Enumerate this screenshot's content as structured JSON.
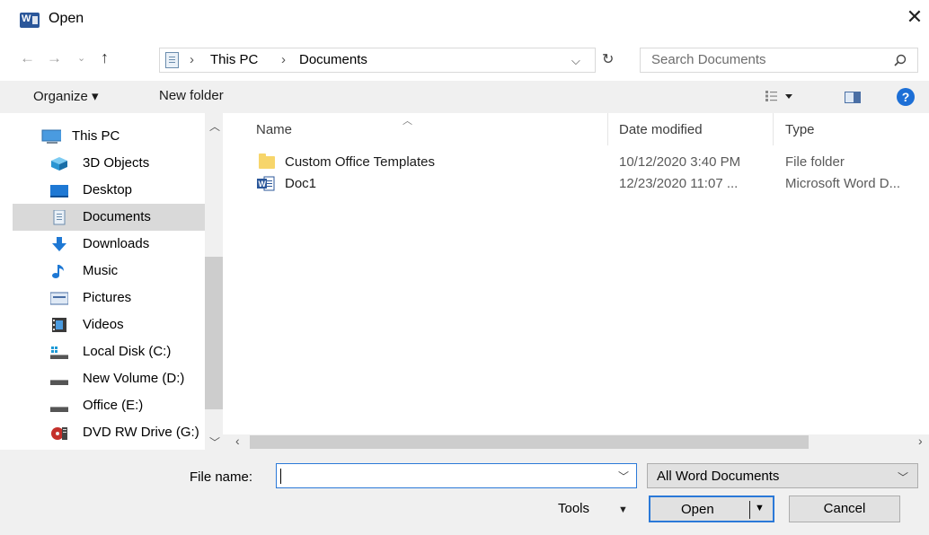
{
  "window": {
    "title": "Open",
    "icon": "word-app-icon",
    "close_icon": "close-icon"
  },
  "nav": {
    "back_icon": "arrow-left-icon",
    "forward_icon": "arrow-right-icon",
    "recent_icon": "chevron-down-icon",
    "up_icon": "arrow-up-icon",
    "breadcrumb": [
      "This PC",
      "Documents"
    ],
    "separator": "›",
    "refresh_icon": "refresh-icon",
    "search_placeholder": "Search Documents"
  },
  "toolbar": {
    "organize_label": "Organize ▾",
    "new_folder_label": "New folder",
    "view_icon": "view-options-icon",
    "preview_pane_icon": "preview-pane-icon",
    "help_label": "?"
  },
  "sidebar": {
    "items": [
      {
        "label": "This PC",
        "icon": "computer-icon",
        "selected": false
      },
      {
        "label": "3D Objects",
        "icon": "3d-objects-icon",
        "selected": false
      },
      {
        "label": "Desktop",
        "icon": "desktop-icon",
        "selected": false
      },
      {
        "label": "Documents",
        "icon": "documents-icon",
        "selected": true
      },
      {
        "label": "Downloads",
        "icon": "downloads-icon",
        "selected": false
      },
      {
        "label": "Music",
        "icon": "music-icon",
        "selected": false
      },
      {
        "label": "Pictures",
        "icon": "pictures-icon",
        "selected": false
      },
      {
        "label": "Videos",
        "icon": "videos-icon",
        "selected": false
      },
      {
        "label": "Local Disk (C:)",
        "icon": "local-disk-icon",
        "selected": false
      },
      {
        "label": "New Volume (D:)",
        "icon": "drive-icon",
        "selected": false
      },
      {
        "label": "Office (E:)",
        "icon": "drive-icon",
        "selected": false
      },
      {
        "label": "DVD RW Drive (G:)",
        "icon": "dvd-drive-icon",
        "selected": false
      }
    ]
  },
  "list": {
    "columns": [
      "Name",
      "Date modified",
      "Type"
    ],
    "rows": [
      {
        "name": "Custom Office Templates",
        "date": "10/12/2020 3:40 PM",
        "type": "File folder",
        "icon": "folder-icon"
      },
      {
        "name": "Doc1",
        "date": "12/23/2020 11:07 ...",
        "type": "Microsoft Word D...",
        "icon": "word-document-icon"
      }
    ]
  },
  "footer": {
    "file_name_label": "File name:",
    "file_name_value": "",
    "file_type_value": "All Word Documents",
    "tools_label": "Tools",
    "open_label": "Open",
    "cancel_label": "Cancel"
  },
  "colors": {
    "accent": "#2b79d8",
    "toolbar_bg": "#f0f0f0",
    "selected_bg": "#d9d9d9",
    "word_blue": "#2b579a"
  }
}
